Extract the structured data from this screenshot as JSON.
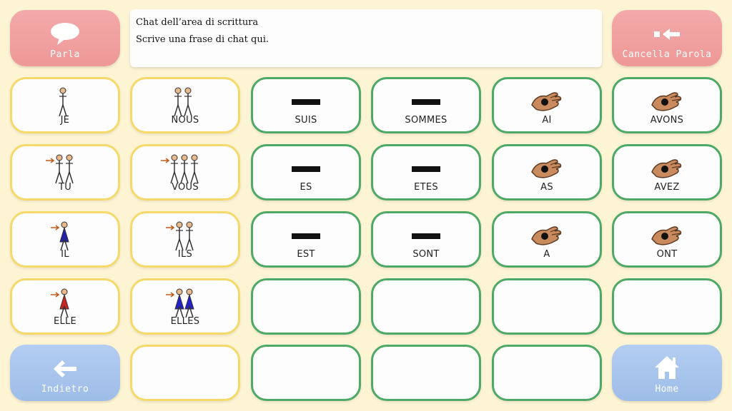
{
  "message_area": {
    "title": "Chat dell’area di scrittura",
    "hint": "Scrive una frase di chat qui."
  },
  "commands": {
    "speak": {
      "label": "Parla",
      "icon": "speech-bubble-icon"
    },
    "clear_word": {
      "label": "Cancella Parola",
      "icon": "delete-word-icon"
    },
    "back": {
      "label": "Indietro",
      "icon": "arrow-left-icon"
    },
    "home": {
      "label": "Home",
      "icon": "house-icon"
    }
  },
  "grid": {
    "rows": [
      [
        {
          "label": "JE",
          "icon": "person-me-icon",
          "color": "yellow"
        },
        {
          "label": "NOUS",
          "icon": "group-we-icon",
          "color": "yellow"
        },
        {
          "label": "SUIS",
          "icon": "dash-icon",
          "color": "green"
        },
        {
          "label": "SOMMES",
          "icon": "dash-icon",
          "color": "green"
        },
        {
          "label": "AI",
          "icon": "hand-have-icon",
          "color": "green"
        },
        {
          "label": "AVONS",
          "icon": "hand-have-icon",
          "color": "green"
        }
      ],
      [
        {
          "label": "TU",
          "icon": "person-you-icon",
          "color": "yellow"
        },
        {
          "label": "VOUS",
          "icon": "group-you-icon",
          "color": "yellow"
        },
        {
          "label": "ES",
          "icon": "dash-icon",
          "color": "green"
        },
        {
          "label": "ETES",
          "icon": "dash-icon",
          "color": "green"
        },
        {
          "label": "AS",
          "icon": "hand-have-icon",
          "color": "green"
        },
        {
          "label": "AVEZ",
          "icon": "hand-have-icon",
          "color": "green"
        }
      ],
      [
        {
          "label": "IL",
          "icon": "person-he-icon",
          "color": "yellow"
        },
        {
          "label": "ILS",
          "icon": "group-they-icon",
          "color": "yellow"
        },
        {
          "label": "EST",
          "icon": "dash-icon",
          "color": "green"
        },
        {
          "label": "SONT",
          "icon": "dash-icon",
          "color": "green"
        },
        {
          "label": "A",
          "icon": "hand-have-icon",
          "color": "green"
        },
        {
          "label": "ONT",
          "icon": "hand-have-icon",
          "color": "green"
        }
      ],
      [
        {
          "label": "ELLE",
          "icon": "person-she-icon",
          "color": "yellow"
        },
        {
          "label": "ELLES",
          "icon": "group-they-female-icon",
          "color": "yellow"
        },
        {
          "label": "",
          "icon": "",
          "color": "green"
        },
        {
          "label": "",
          "icon": "",
          "color": "green"
        },
        {
          "label": "",
          "icon": "",
          "color": "green"
        },
        {
          "label": "",
          "icon": "",
          "color": "green"
        }
      ],
      [
        null,
        {
          "label": "",
          "icon": "",
          "color": "yellow"
        },
        {
          "label": "",
          "icon": "",
          "color": "green"
        },
        {
          "label": "",
          "icon": "",
          "color": "green"
        },
        {
          "label": "",
          "icon": "",
          "color": "green"
        },
        null
      ]
    ]
  },
  "colors": {
    "background": "#fdf4d4",
    "pronoun_border": "#f5d96a",
    "verb_border": "#4ea866",
    "command_red": "#ef9d9c",
    "command_blue": "#a5c3ec"
  }
}
